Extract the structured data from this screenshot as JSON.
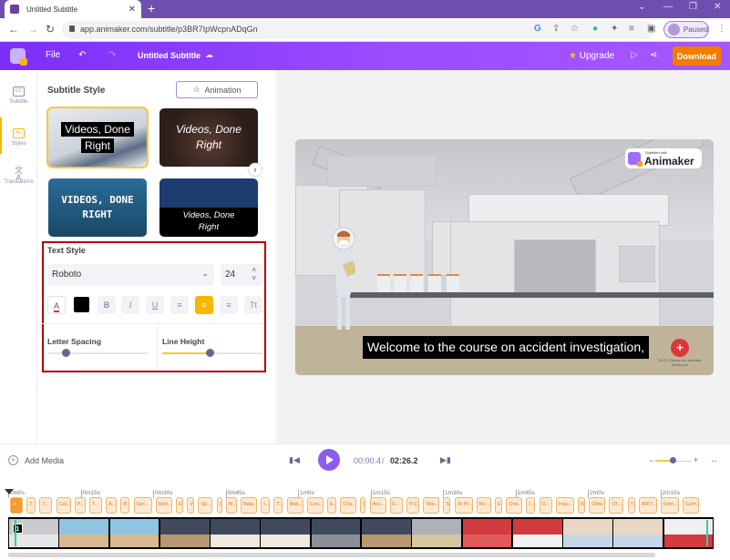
{
  "browser": {
    "tab_title": "Untitled Subtitle",
    "url": "app.animaker.com/subtitle/p3BR7IpWcpnADqGn",
    "profile_status": "Paused"
  },
  "header": {
    "file_label": "File",
    "title": "Untitled Subtitle",
    "upgrade_label": "Upgrade",
    "download_label": "Download"
  },
  "sidebar": {
    "items": [
      {
        "label": "Subtitle",
        "icon": "cc-icon"
      },
      {
        "label": "Styles",
        "icon": "styles-icon",
        "active": true
      },
      {
        "label": "Translations",
        "icon": "translate-icon"
      }
    ]
  },
  "panel": {
    "title": "Subtitle Style",
    "animation_label": "Animation",
    "style_cards": [
      {
        "line1": "Videos, Done",
        "line2": "Right",
        "selected": true
      },
      {
        "line1": "Videos, Done",
        "line2": "Right"
      },
      {
        "line1": "VIDEOS, DONE",
        "line2": "RIGHT"
      },
      {
        "line1": "Videos, Done",
        "line2": "Right"
      }
    ],
    "text_style": {
      "label": "Text Style",
      "font": "Roboto",
      "size": "24",
      "text_color": "#000000",
      "alignment": "center",
      "letter_spacing_label": "Letter Spacing",
      "line_height_label": "Line Height",
      "letter_spacing_value": 0.1,
      "line_height_value": 0.45,
      "buttons": {
        "bold": "B",
        "italic": "I",
        "underline": "U",
        "case": "Tt",
        "color_a": "A"
      }
    }
  },
  "preview": {
    "subtitle_text": "Welcome to the course on accident investigation,",
    "watermark_small": "Subtitled with",
    "watermark_brand": "Animaker",
    "logo_text": "F.A.S.T. Rescue Inc. www.fast-rescue.com"
  },
  "controls": {
    "add_media_label": "Add Media",
    "current_time": "00:00.4",
    "separator": "/",
    "total_time": "02:26.2",
    "zoom_level": 0.45
  },
  "timeline": {
    "ticks": [
      "0m0s",
      "0m15s",
      "0m30s",
      "0m45s",
      "1m0s",
      "1m15s",
      "1m30s",
      "1m45s",
      "2m0s",
      "2m15s"
    ],
    "subtitle_blocks": [
      "",
      "T",
      "T...",
      "Cal...",
      "P...",
      "T...",
      "A...",
      "R...",
      "Sec...",
      "Iden...",
      "E...",
      "V...",
      "Sp...",
      "I...",
      "M...",
      "Bala...",
      "I...",
      "T...",
      "Mak...",
      "Con...",
      "E...",
      "Cha...",
      "C...",
      "Ass...",
      "E...",
      "If C...",
      "She...",
      "S...",
      "To Pr...",
      "Be ...",
      "E...",
      "One...",
      "I...",
      "G...",
      "Inqu...",
      "W...",
      "Obta...",
      "Of ...",
      "Y...",
      "8667...",
      "Exte...",
      "Com..."
    ],
    "scene_marker": "1"
  },
  "colors": {
    "brand_purple": "#8c5cf0",
    "accent_yellow": "#f5b800",
    "download_orange": "#f57c00",
    "subtitle_block": "#f3b46b"
  }
}
